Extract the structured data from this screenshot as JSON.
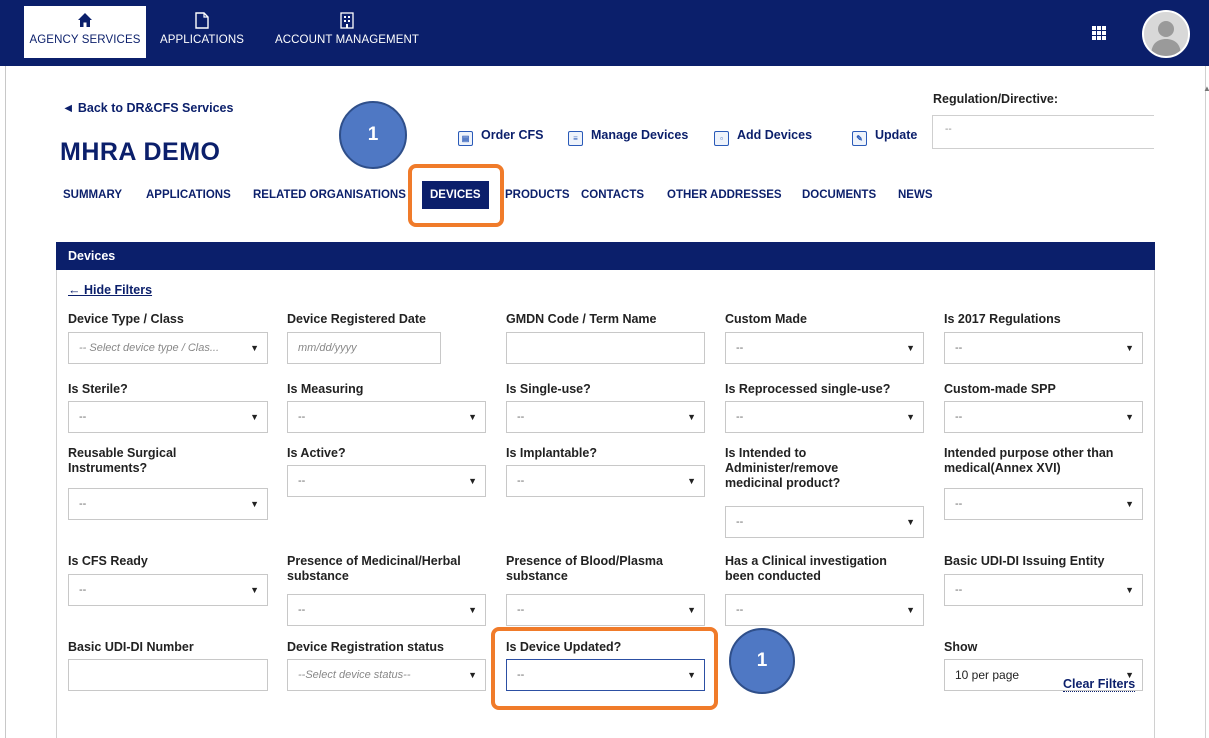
{
  "topnav": {
    "tabs": [
      {
        "label": "AGENCY SERVICES",
        "icon": "home-icon"
      },
      {
        "label": "APPLICATIONS",
        "icon": "document-icon"
      },
      {
        "label": "ACCOUNT MANAGEMENT",
        "icon": "building-icon"
      }
    ],
    "active_tab": "AGENCY SERVICES"
  },
  "page": {
    "back_link": "◄ Back to DR&CFS Services",
    "title": "MHRA DEMO",
    "reg_directive_label": "Regulation/Directive:",
    "reg_directive_value": "--",
    "actions": [
      "Order CFS",
      "Manage Devices",
      "Add Devices",
      "Update"
    ]
  },
  "subnav": {
    "tabs": [
      "SUMMARY",
      "APPLICATIONS",
      "RELATED ORGANISATIONS",
      "DEVICES",
      "PRODUCTS",
      "CONTACTS",
      "OTHER ADDRESSES",
      "DOCUMENTS",
      "NEWS"
    ],
    "active": "DEVICES"
  },
  "annotations": {
    "badge_label": "1",
    "highlight_color": "#f07b2a"
  },
  "devices_panel": {
    "title": "Devices",
    "hide_filters": "← Hide Filters",
    "clear_filters": "Clear Filters",
    "filters": {
      "device_type": {
        "label": "Device Type / Class",
        "value": "-- Select device type / Clas..."
      },
      "registered_date": {
        "label": "Device Registered Date",
        "placeholder": "mm/dd/yyyy"
      },
      "gmdn": {
        "label": "GMDN Code / Term Name",
        "value": ""
      },
      "custom_made": {
        "label": "Custom Made",
        "value": "--"
      },
      "is_2017": {
        "label": "Is 2017 Regulations",
        "value": "--"
      },
      "is_sterile": {
        "label": "Is Sterile?",
        "value": "--"
      },
      "is_measuring": {
        "label": "Is Measuring",
        "value": "--"
      },
      "is_single_use": {
        "label": "Is Single-use?",
        "value": "--"
      },
      "is_reprocessed": {
        "label": "Is Reprocessed single-use?",
        "value": "--"
      },
      "custom_spp": {
        "label": "Custom-made SPP",
        "value": "--"
      },
      "reusable_surgical": {
        "label1": "Reusable Surgical",
        "label2": "Instruments?",
        "value": "--"
      },
      "is_active": {
        "label": "Is Active?",
        "value": "--"
      },
      "is_implantable": {
        "label": "Is Implantable?",
        "value": "--"
      },
      "is_intended": {
        "label1": "Is Intended to",
        "label2": "Administer/remove",
        "label3": "medicinal product?",
        "value": "--"
      },
      "intended_purpose": {
        "label1": "Intended purpose other than",
        "label2": "medical(Annex XVI)",
        "value": "--"
      },
      "is_cfs_ready": {
        "label": "Is CFS Ready",
        "value": "--"
      },
      "medicinal_herbal": {
        "label1": "Presence of Medicinal/Herbal",
        "label2": "substance",
        "value": "--"
      },
      "blood_plasma": {
        "label1": "Presence of Blood/Plasma",
        "label2": "substance",
        "value": "--"
      },
      "clinical": {
        "label1": "Has a Clinical investigation",
        "label2": "been conducted",
        "value": "--"
      },
      "basic_udi_entity": {
        "label": "Basic UDI-DI Issuing Entity",
        "value": "--"
      },
      "basic_udi_number": {
        "label": "Basic UDI-DI Number",
        "value": ""
      },
      "registration_status": {
        "label": "Device Registration status",
        "value": "--Select device status--"
      },
      "is_updated": {
        "label": "Is Device Updated?",
        "value": "--"
      },
      "show": {
        "label": "Show",
        "value": "10 per page"
      }
    }
  }
}
